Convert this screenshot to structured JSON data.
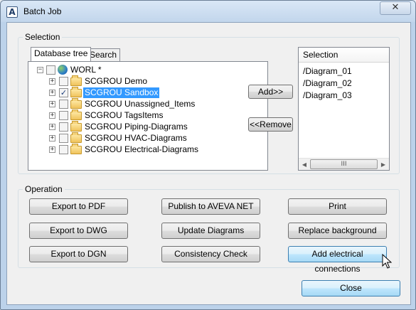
{
  "window": {
    "title": "Batch Job",
    "close_glyph": "✕",
    "app_icon_glyph": "A"
  },
  "selection": {
    "group_label": "Selection",
    "tabs": [
      {
        "label": "Database tree",
        "active": true
      },
      {
        "label": "Search",
        "active": false
      }
    ],
    "tree": {
      "root": {
        "label": "WORL *",
        "expander": "−",
        "icon": "globe-icon"
      },
      "children": [
        {
          "label": "SCGROU Demo",
          "checked": false,
          "selected": false
        },
        {
          "label": "SCGROU Sandbox",
          "checked": true,
          "selected": true
        },
        {
          "label": "SCGROU Unassigned_Items",
          "checked": false,
          "selected": false
        },
        {
          "label": "SCGROU TagsItems",
          "checked": false,
          "selected": false
        },
        {
          "label": "SCGROU Piping-Diagrams",
          "checked": false,
          "selected": false
        },
        {
          "label": "SCGROU HVAC-Diagrams",
          "checked": false,
          "selected": false
        },
        {
          "label": "SCGROU Electrical-Diagrams",
          "checked": false,
          "selected": false
        }
      ],
      "child_expander": "+",
      "check_glyph": "✓"
    },
    "add_button": "Add>>",
    "remove_button": "<<Remove",
    "list": {
      "header": "Selection",
      "items": [
        "/Diagram_01",
        "/Diagram_02",
        "/Diagram_03"
      ],
      "scroll_left": "◀",
      "scroll_right": "▶",
      "thumb_grip": "III"
    }
  },
  "operation": {
    "group_label": "Operation",
    "buttons": [
      [
        "Export to PDF",
        "Publish to AVEVA NET",
        "Print"
      ],
      [
        "Export to DWG",
        "Update Diagrams",
        "Replace background"
      ],
      [
        "Export to DGN",
        "Consistency Check",
        "Add electrical connections"
      ]
    ]
  },
  "close_button": "Close",
  "colors": {
    "selection_highlight": "#3399ff",
    "hover_button": "#bee6fd"
  }
}
